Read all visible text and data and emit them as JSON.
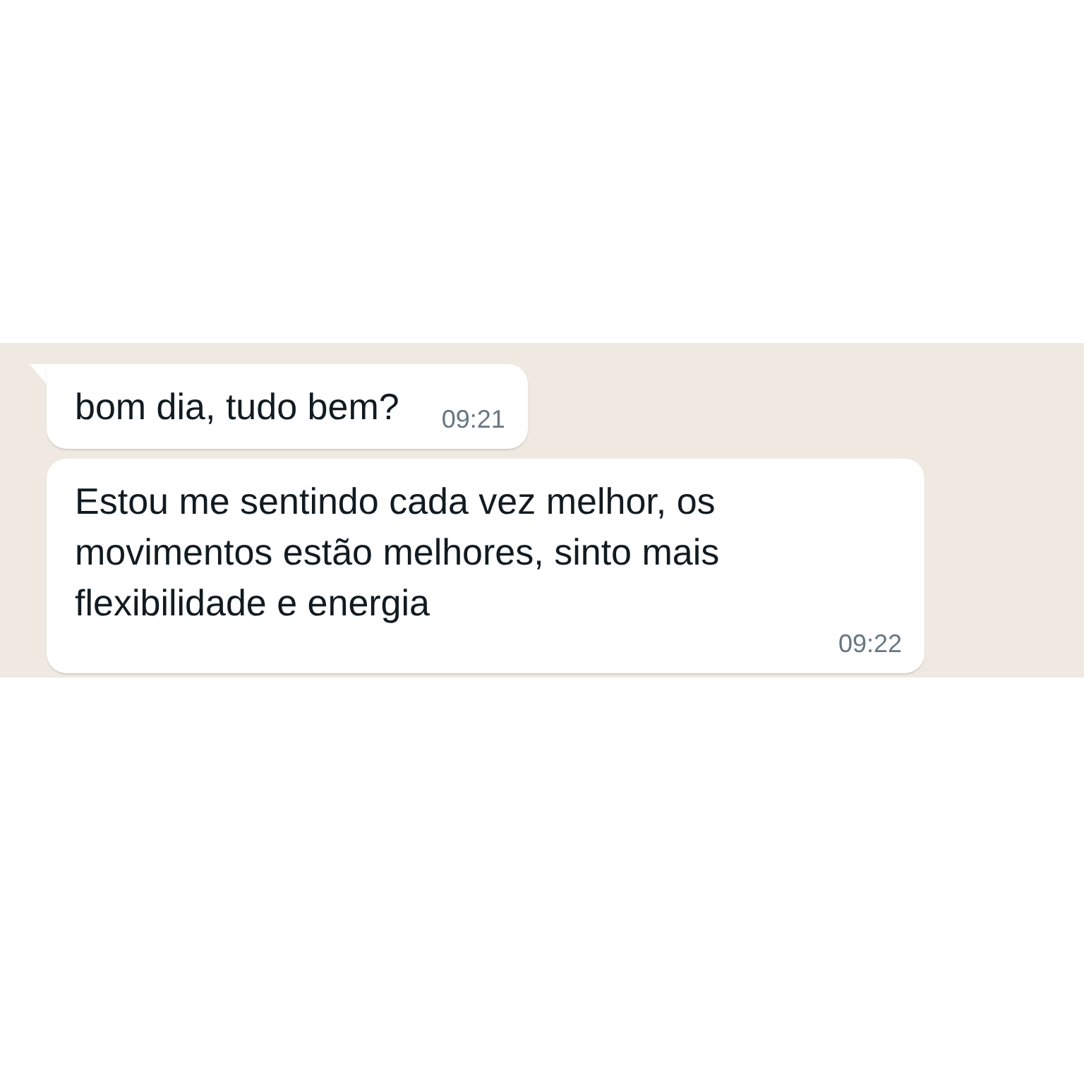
{
  "messages": [
    {
      "text": "bom dia, tudo bem?",
      "time": "09:21",
      "tail": true
    },
    {
      "text": "Estou me sentindo cada vez melhor, os movimentos estão melhores, sinto mais flexibilidade e energia",
      "time": "09:22",
      "tail": false
    }
  ]
}
